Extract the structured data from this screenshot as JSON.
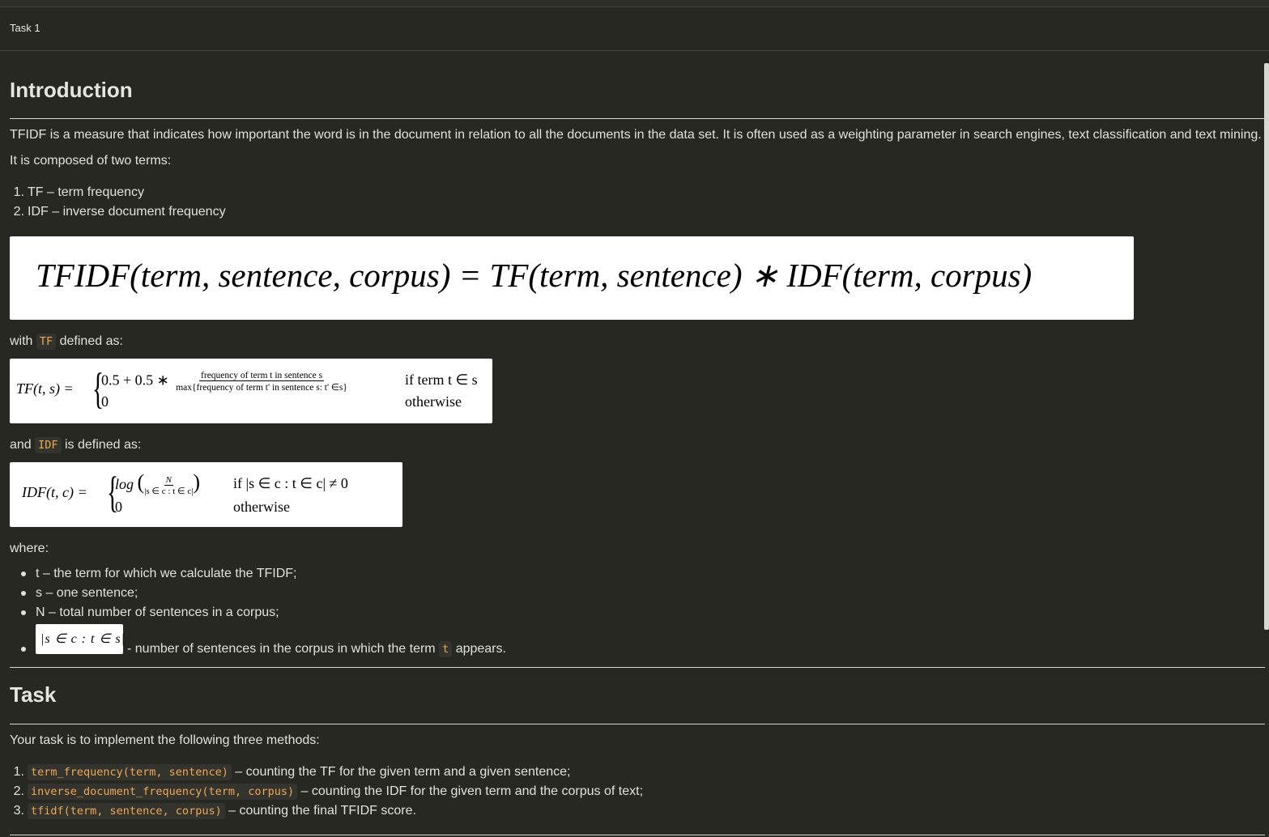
{
  "header": {
    "tab_title": "Task 1"
  },
  "intro": {
    "heading": "Introduction",
    "p1": "TFIDF is a measure that indicates how important the word is in the document in relation to all the documents in the data set. It is often used as a weighting parameter in search engines, text classification and text mining.",
    "p2": "It is composed of two terms:",
    "terms": [
      "TF – term frequency",
      "IDF – inverse document frequency"
    ],
    "main_formula": "TFIDF(term, sentence, corpus) = TF(term, sentence) ∗ IDF(term, corpus)",
    "with_pre": "with",
    "tf_code": "TF",
    "with_post": "defined as:",
    "tf_formula": {
      "lhs": "TF(t, s) =",
      "case1": "0.5 + 0.5 ∗",
      "num": "frequency of term t in sentence s",
      "den": "max{frequency of term t' in sentence s: t' ∈s}",
      "cond1": "if term t ∈ s",
      "case2": "0",
      "cond2": "otherwise"
    },
    "and_pre": "and",
    "idf_code": "IDF",
    "and_post": "is defined as:",
    "idf_formula": {
      "lhs": "IDF(t, c) =",
      "case1": "log",
      "num": "N",
      "den": "|s ∈ c : t ∈ c|",
      "cond1": "if |s ∈ c : t ∈ c| ≠ 0",
      "case2": "0",
      "cond2": "otherwise"
    },
    "where": "where:",
    "defs": [
      "t – the term for which we calculate the TFIDF;",
      "s – one sentence;",
      "N – total number of sentences in a corpus;"
    ],
    "def4_math": "|s ∈ c : t ∈ s|",
    "def4_pre": "- number of sentences in the corpus in which the term",
    "def4_code": "t",
    "def4_post": "appears."
  },
  "task": {
    "heading": "Task",
    "p": "Your task is to implement the following three methods:",
    "methods": [
      {
        "num": "1.",
        "code": "term_frequency(term, sentence)",
        "desc": "– counting the TF for the given term and a given sentence;"
      },
      {
        "num": "2.",
        "code": "inverse_document_frequency(term, corpus)",
        "desc": "– counting the IDF for the given term and the corpus of text;"
      },
      {
        "num": "3.",
        "code": "tfidf(term, sentence, corpus)",
        "desc": "– counting the final TFIDF score."
      }
    ]
  }
}
